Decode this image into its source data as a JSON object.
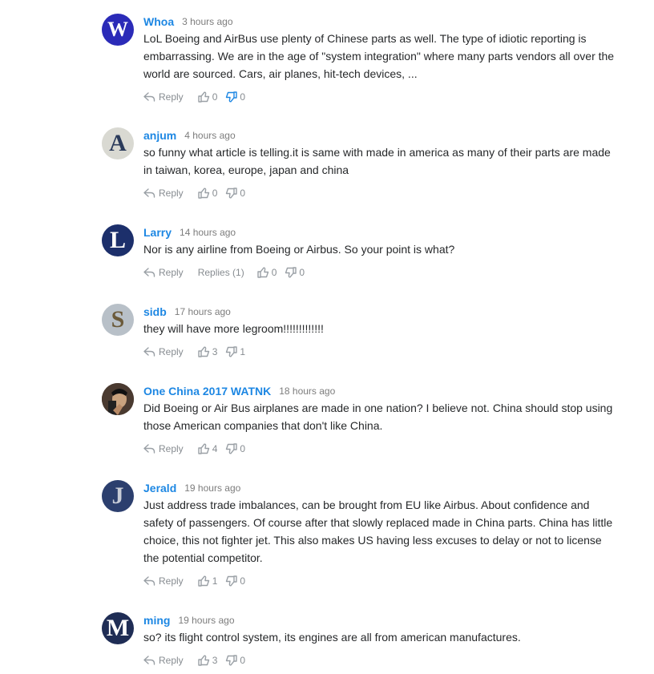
{
  "labels": {
    "reply": "Reply"
  },
  "comments": [
    {
      "author": "Whoa",
      "time": "3 hours ago",
      "text": "LoL Boeing and AirBus use plenty of Chinese parts as well. The type of idiotic reporting is embarrassing. We are in the age of \"system integration\" where many parts vendors all over the world are sourced. Cars, air planes, hit-tech devices, ...",
      "likes": "0",
      "dislikes": "0",
      "avatar": {
        "letter": "W",
        "bg": "#2b2bb8",
        "fg": "#ffffff"
      }
    },
    {
      "author": "anjum",
      "time": "4 hours ago",
      "text": "so funny what article is telling.it is same with made in america as many of their parts are made in taiwan, korea, europe, japan and china",
      "likes": "0",
      "dislikes": "0",
      "avatar": {
        "letter": "A",
        "bg": "#d9d9d2",
        "fg": "#2a3a5a"
      }
    },
    {
      "author": "Larry",
      "time": "14 hours ago",
      "text": "Nor is any airline from Boeing or Airbus. So your point is what?",
      "replies": "Replies (1)",
      "likes": "0",
      "dislikes": "0",
      "avatar": {
        "letter": "L",
        "bg": "#1c2f6b",
        "fg": "#ffffff"
      }
    },
    {
      "author": "sidb",
      "time": "17 hours ago",
      "text": "they will have more legroom!!!!!!!!!!!!!",
      "likes": "3",
      "dislikes": "1",
      "avatar": {
        "letter": "S",
        "bg": "#b8c0c8",
        "fg": "#6b5a3a"
      }
    },
    {
      "author": "One China 2017 WATNK",
      "time": "18 hours ago",
      "text": "Did Boeing or Air Bus airplanes are made in one nation? I believe not. China should stop using those American companies that don't like China.",
      "likes": "4",
      "dislikes": "0",
      "avatar": {
        "letter": "",
        "bg": "#3a2a22",
        "fg": "#e0c0a0",
        "photo": true
      }
    },
    {
      "author": "Jerald",
      "time": "19 hours ago",
      "text": "Just address trade imbalances, can be brought from EU like Airbus. About confidence and safety of passengers. Of course after that slowly replaced made in China parts. China has little choice, this not fighter jet. This also makes US having less excuses to delay or not to license the potential competitor.",
      "likes": "1",
      "dislikes": "0",
      "avatar": {
        "letter": "J",
        "bg": "#2c3f6e",
        "fg": "#c8ccd6"
      }
    },
    {
      "author": "ming",
      "time": "19 hours ago",
      "text": "so? its flight control system, its engines are all from american manufactures.",
      "likes": "3",
      "dislikes": "0",
      "avatar": {
        "letter": "M",
        "bg": "#1f2d55",
        "fg": "#ffffff"
      }
    }
  ]
}
